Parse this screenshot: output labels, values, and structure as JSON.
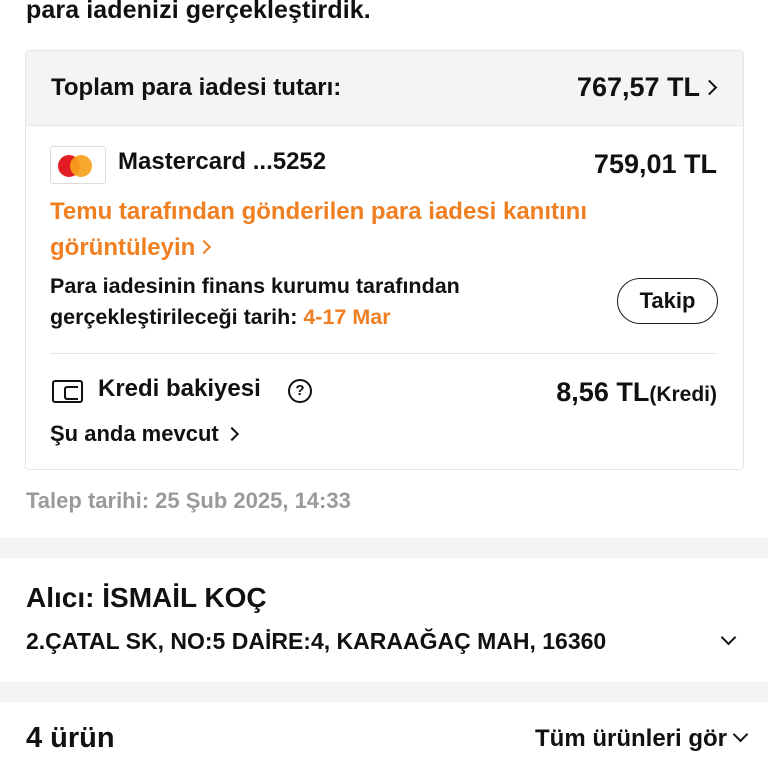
{
  "header": {
    "message_tail": "para iadenizi gerçekleştirdik."
  },
  "refund": {
    "total_label": "Toplam para iadesi tutarı:",
    "total_amount": "767,57 TL",
    "card": {
      "logo": "mastercard-logo",
      "name": "Mastercard ...5252",
      "amount": "759,01 TL"
    },
    "proof_link": "Temu tarafından gönderilen para iadesi kanıtını görüntüleyin",
    "finance_text": "Para iadesinin finans kurumu tarafından gerçekleştirileceği tarih: ",
    "finance_date": "4-17 Mar",
    "track_button": "Takip",
    "credit": {
      "icon": "wallet-icon",
      "label": "Kredi bakiyesi",
      "info_icon": "?",
      "value": "8,56 TL",
      "unit": "(Kredi)",
      "availability": "Şu anda mevcut"
    }
  },
  "request_date": "Talep tarihi: 25 Şub 2025, 14:33",
  "recipient": {
    "name": "Alıcı: İSMAİL KOÇ",
    "address": "2.ÇATAL SK, NO:5 DAİRE:4, KARAAĞAÇ MAH, 16360"
  },
  "items": {
    "count": "4 ürün",
    "view_all": "Tüm ürünleri gör"
  },
  "colors": {
    "accent_orange": "#f07f22",
    "muted_text": "#9a9a9a",
    "section_bg": "#f4f4f4"
  }
}
